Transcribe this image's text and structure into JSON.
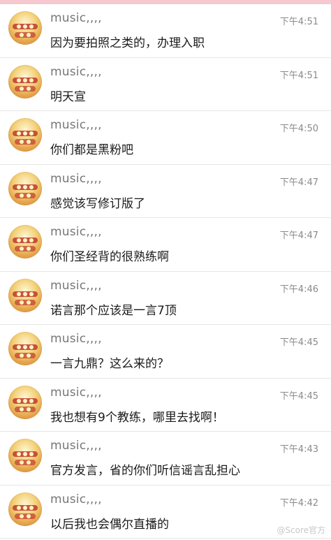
{
  "messages": [
    {
      "name": "music,,,,",
      "time": "下午4:51",
      "text": "因为要拍照之类的，办理入职"
    },
    {
      "name": "music,,,,",
      "time": "下午4:51",
      "text": "明天宣"
    },
    {
      "name": "music,,,,",
      "time": "下午4:50",
      "text": "你们都是黑粉吧"
    },
    {
      "name": "music,,,,",
      "time": "下午4:47",
      "text": "感觉该写修订版了"
    },
    {
      "name": "music,,,,",
      "time": "下午4:47",
      "text": "你们圣经背的很熟练啊"
    },
    {
      "name": "music,,,,",
      "time": "下午4:46",
      "text": "诺言那个应该是一言7顶"
    },
    {
      "name": "music,,,,",
      "time": "下午4:45",
      "text": "一言九鼎？这么来的？"
    },
    {
      "name": "music,,,,",
      "time": "下午4:45",
      "text": "我也想有9个教练，哪里去找啊！"
    },
    {
      "name": "music,,,,",
      "time": "下午4:43",
      "text": "官方发言，省的你们听信谣言乱担心"
    },
    {
      "name": "music,,,,",
      "time": "下午4:42",
      "text": "以后我也会偶尔直播的"
    }
  ],
  "watermark": "@Score官方",
  "icons": {
    "avatar": "avatar-image"
  },
  "colors": {
    "top_strip": "#f6c8cf",
    "name_text": "#777777",
    "time_text": "#8a8a8a",
    "message_text": "#1a1a1a",
    "divider": "#e6e6e6"
  }
}
